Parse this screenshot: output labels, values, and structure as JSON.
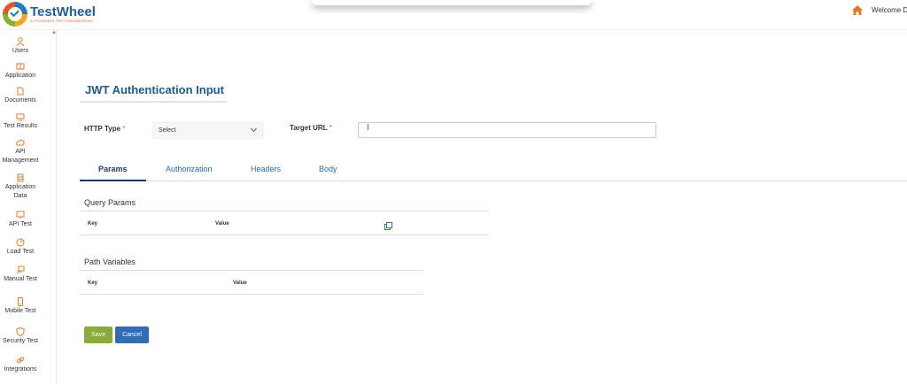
{
  "brand": {
    "name": "TestWheel",
    "tagline": "AI POWERED TEST ENGINEERING"
  },
  "header": {
    "welcome": "Welcome Dil"
  },
  "sidebar": {
    "items": [
      {
        "label": "Users"
      },
      {
        "label": "Application"
      },
      {
        "label": "Documents"
      },
      {
        "label": "Test Results"
      },
      {
        "label": "API Management"
      },
      {
        "label": "Application Data"
      },
      {
        "label": "API Test"
      },
      {
        "label": "Load Test"
      },
      {
        "label": "Manual Test"
      },
      {
        "label": "Mobile Test"
      },
      {
        "label": "Security Test"
      },
      {
        "label": "Integrations"
      }
    ]
  },
  "page": {
    "title": "JWT Authentication Input"
  },
  "form": {
    "http_type_label": "HTTP Type",
    "required_mark": "*",
    "http_type_value": "Select",
    "target_url_label": "Target URL",
    "target_url_value": ""
  },
  "tabs": [
    {
      "label": "Params",
      "active": true
    },
    {
      "label": "Authorization"
    },
    {
      "label": "Headers"
    },
    {
      "label": "Body"
    }
  ],
  "query_params": {
    "title": "Query Params",
    "columns": [
      "Key",
      "Value"
    ]
  },
  "path_variables": {
    "title": "Path Variables",
    "columns": [
      "Key",
      "Value"
    ]
  },
  "actions": {
    "save": "Save",
    "cancel": "Cancel"
  },
  "colors": {
    "accent": "#1e5a8a",
    "save": "#8aab3a",
    "cancel": "#2f6db5",
    "required": "#e05a28"
  }
}
